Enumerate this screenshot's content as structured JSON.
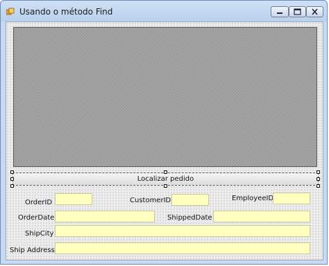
{
  "window": {
    "title": "Usando o método Find"
  },
  "controls": {
    "minimize": "minimize",
    "maximize": "maximize",
    "close": "close"
  },
  "button": {
    "label": "Localizar pedido"
  },
  "fields": {
    "order_id": {
      "label": "OrderID",
      "value": ""
    },
    "customer_id": {
      "label": "CustomerID",
      "value": ""
    },
    "employee_id": {
      "label": "EmployeeID",
      "value": ""
    },
    "order_date": {
      "label": "OrderDate",
      "value": ""
    },
    "shipped_date": {
      "label": "ShippedDate",
      "value": ""
    },
    "ship_city": {
      "label": "ShipCity",
      "value": ""
    },
    "ship_address": {
      "label": "Ship Address",
      "value": ""
    }
  },
  "colors": {
    "field_bg": "#ffffc0",
    "grid_bg": "#a0a0a0"
  }
}
